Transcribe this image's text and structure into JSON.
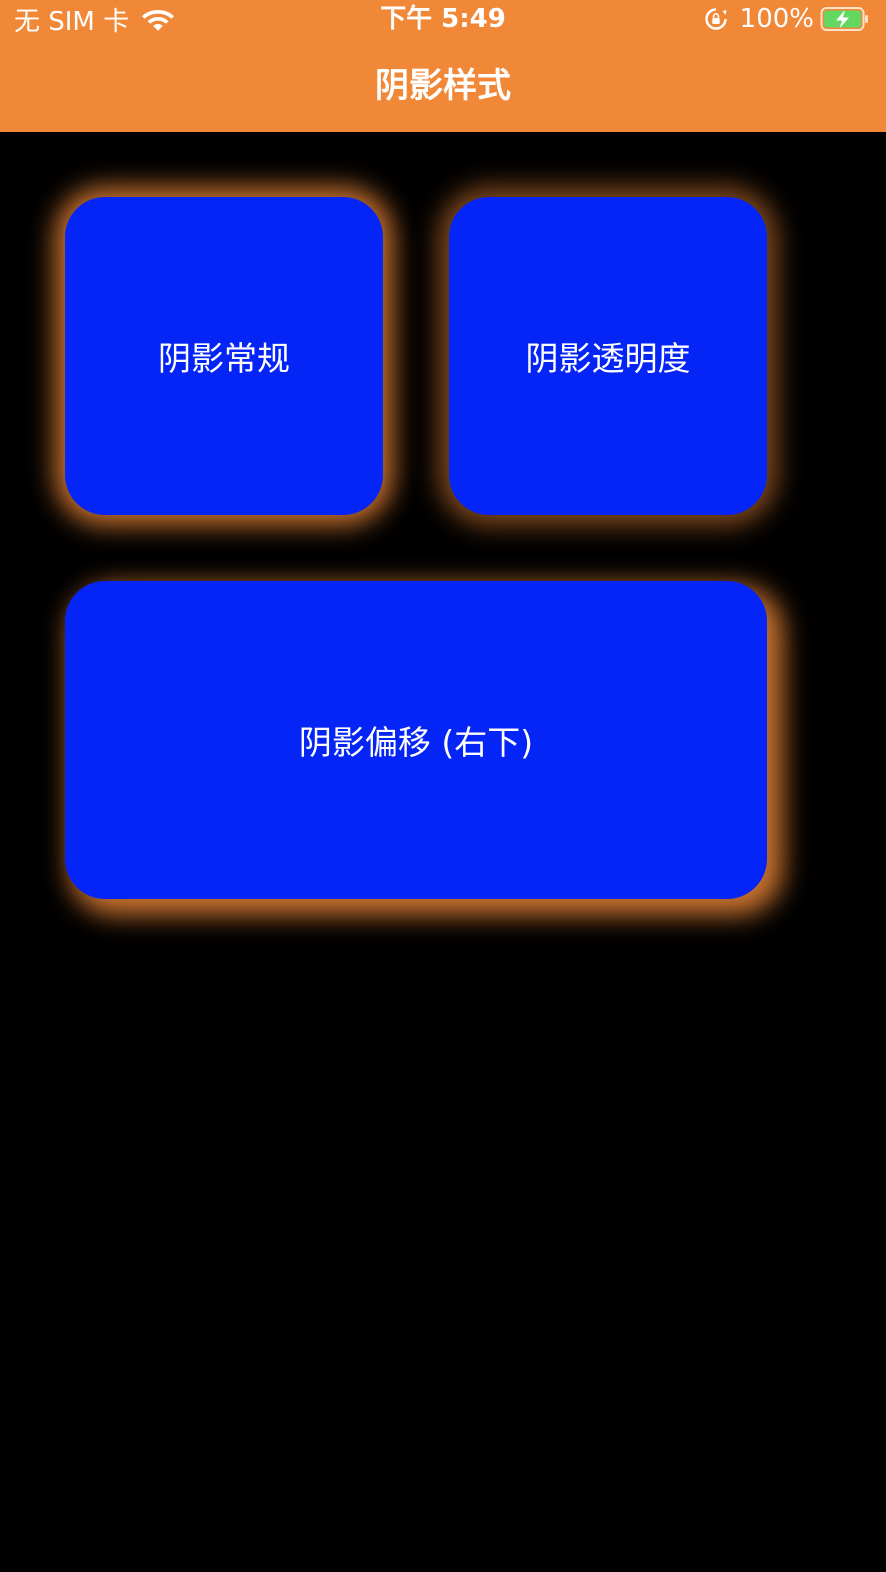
{
  "status_bar": {
    "carrier": "无 SIM 卡",
    "time": "下午 5:49",
    "battery": "100%"
  },
  "nav": {
    "title": "阴影样式"
  },
  "cards": {
    "normal": "阴影常规",
    "opacity": "阴影透明度",
    "offset": "阴影偏移 (右下)"
  },
  "colors": {
    "nav_background": "#F08838",
    "card_background": "#0524F6",
    "shadow": "#F08838",
    "page_background": "#000000"
  },
  "icons": {
    "wifi": "wifi-icon",
    "orientation_lock": "lock-rotation-icon",
    "battery": "battery-charging-icon"
  }
}
